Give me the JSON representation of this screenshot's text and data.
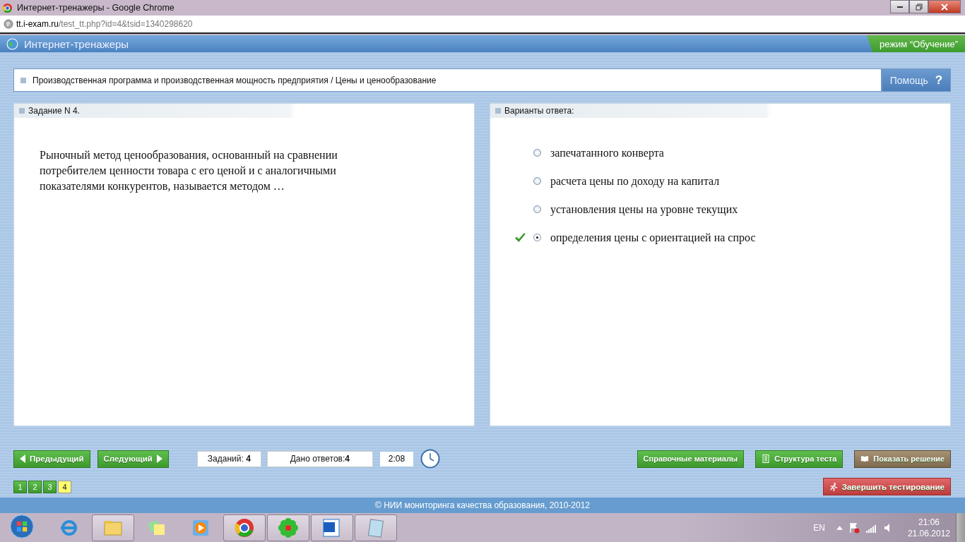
{
  "window": {
    "title": "Интернет-тренажеры - Google Chrome"
  },
  "address": {
    "domain": "tt.i-exam.ru",
    "path": "/test_tt.php?id=4&tsid=1340298620"
  },
  "app": {
    "title": "Интернет-тренажеры",
    "mode": "режим “Обучение”"
  },
  "breadcrumb": "Производственная программа и производственная мощность предприятия / Цены и ценообразование",
  "help_button": {
    "label": "Помощь",
    "icon": "?"
  },
  "task": {
    "heading": "Задание N 4.",
    "question": "Рыночный метод ценообразования, основанный на сравнении потребителем ценности товара с его ценой и с аналогичными показателями конкурентов, называется методом …"
  },
  "answers": {
    "heading": "Варианты ответа:",
    "options": [
      {
        "text": "запечатанного конверта",
        "selected": false,
        "correct": false
      },
      {
        "text": "расчета цены по доходу на капитал",
        "selected": false,
        "correct": false
      },
      {
        "text": "установления цены на уровне текущих",
        "selected": false,
        "correct": false
      },
      {
        "text": "определения цены с ориентацией на спрос",
        "selected": true,
        "correct": true
      }
    ]
  },
  "nav": {
    "prev": "Предыдущий",
    "next": "Следующий"
  },
  "counters": [
    "Заданий: **4**",
    "Дано ответов:**4**"
  ],
  "timer": "2:08",
  "buttons": [
    {
      "label": "Справочные материалы",
      "kind": "reference"
    },
    {
      "label": "Структура теста",
      "kind": "structure"
    },
    {
      "label": "Показать решение",
      "kind": "solution"
    }
  ],
  "pages": [
    {
      "label": "1",
      "selected": false
    },
    {
      "label": "2",
      "selected": false
    },
    {
      "label": "3",
      "selected": false
    },
    {
      "label": "4",
      "selected": true
    }
  ],
  "finish_button": "Завершить тестирование",
  "footer": "© НИИ мониторинга качества образования, 2010-2012",
  "taskbar": {
    "language": "EN",
    "time": "21:06",
    "date": "21.06.2012"
  }
}
